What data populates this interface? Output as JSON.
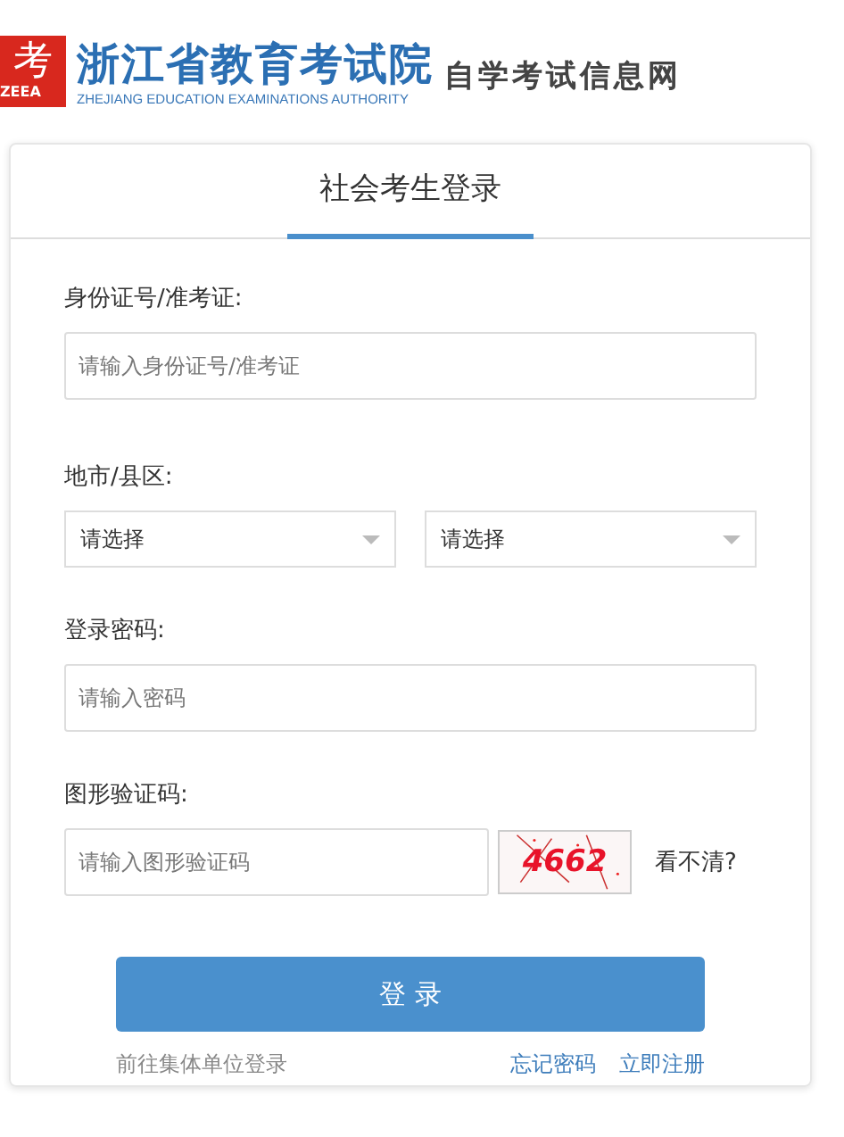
{
  "header": {
    "logo": {
      "glyph": "考",
      "abbr": "ZEEA"
    },
    "title": "浙江省教育考试院",
    "subtitle": "ZHEJIANG EDUCATION EXAMINATIONS AUTHORITY",
    "site_name": "自学考试信息网"
  },
  "tabs": [
    {
      "label": "社会考生登录",
      "selected": true
    }
  ],
  "fields": [
    {
      "kind": "text",
      "label": "身份证号/准考证:",
      "placeholder": "请输入身份证号/准考证"
    },
    {
      "kind": "selects",
      "label": "地市/县区:",
      "selects": [
        {
          "value": "请选择"
        },
        {
          "value": "请选择"
        }
      ]
    },
    {
      "kind": "password",
      "label": "登录密码:",
      "placeholder": "请输入密码"
    },
    {
      "kind": "captcha",
      "label": "图形验证码:",
      "placeholder": "请输入图形验证码",
      "captcha": "4662",
      "refresh": "看不清?"
    }
  ],
  "submit": "登 录",
  "links": [
    {
      "label": "前往集体单位登录",
      "kind": "muted"
    },
    {
      "label": "忘记密码",
      "kind": "link"
    },
    {
      "label": "立即注册",
      "kind": "link"
    }
  ]
}
